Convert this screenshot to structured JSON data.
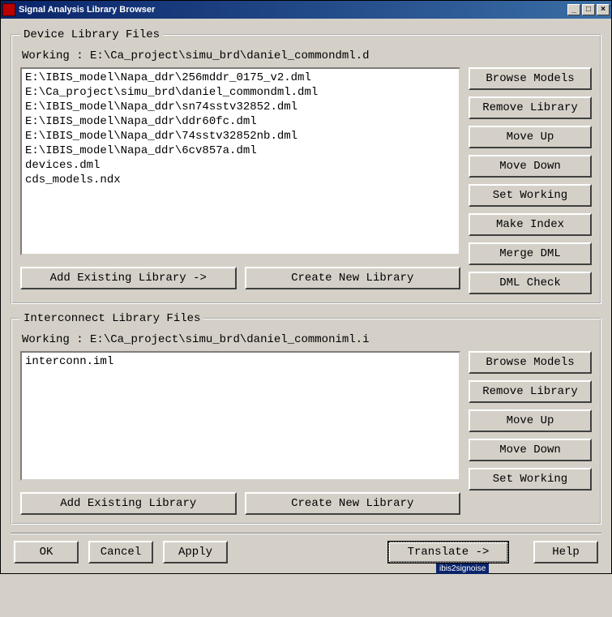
{
  "titlebar": {
    "title": "Signal Analysis Library Browser"
  },
  "device": {
    "legend": "Device Library Files",
    "working_label": "Working :",
    "working_path": "E:\\Ca_project\\simu_brd\\daniel_commondml.d",
    "items": [
      "E:\\IBIS_model\\Napa_ddr\\256mddr_0175_v2.dml",
      "E:\\Ca_project\\simu_brd\\daniel_commondml.dml",
      "E:\\IBIS_model\\Napa_ddr\\sn74sstv32852.dml",
      "E:\\IBIS_model\\Napa_ddr\\ddr60fc.dml",
      "E:\\IBIS_model\\Napa_ddr\\74sstv32852nb.dml",
      "E:\\IBIS_model\\Napa_ddr\\6cv857a.dml",
      "devices.dml",
      "cds_models.ndx"
    ],
    "buttons": {
      "browse": "Browse Models",
      "remove": "Remove Library",
      "moveup": "Move Up",
      "movedown": "Move Down",
      "setworking": "Set Working",
      "makeindex": "Make Index",
      "mergedml": "Merge DML",
      "dmlcheck": "DML Check",
      "addexisting": "Add Existing Library ->",
      "createnew": "Create New Library"
    }
  },
  "interconnect": {
    "legend": "Interconnect Library Files",
    "working_label": "Working :",
    "working_path": "E:\\Ca_project\\simu_brd\\daniel_commoniml.i",
    "items": [
      "interconn.iml"
    ],
    "buttons": {
      "browse": "Browse Models",
      "remove": "Remove Library",
      "moveup": "Move Up",
      "movedown": "Move Down",
      "setworking": "Set Working",
      "addexisting": "Add Existing Library",
      "createnew": "Create New Library"
    }
  },
  "footer": {
    "ok": "OK",
    "cancel": "Cancel",
    "apply": "Apply",
    "translate": "Translate ->",
    "help": "Help",
    "hint": "ibis2signoise"
  }
}
